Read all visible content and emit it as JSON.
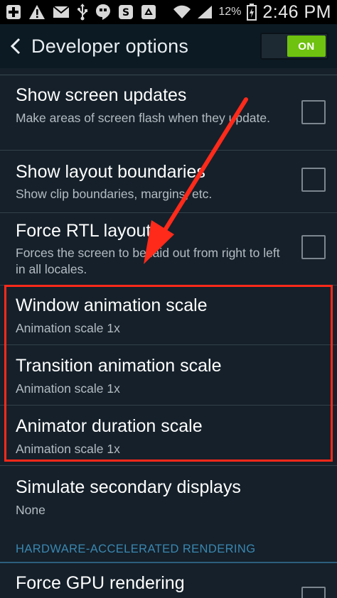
{
  "status_bar": {
    "battery_percent": "12%",
    "time": "2:46 PM",
    "left_icons": [
      "medical-plus-icon",
      "warning-icon",
      "mail-icon",
      "usb-icon",
      "hangouts-icon",
      "skype-icon",
      "recycle-icon"
    ],
    "right_icons": [
      "wifi-icon",
      "signal-icon",
      "battery-charging-icon"
    ]
  },
  "action_bar": {
    "title": "Developer options",
    "toggle_label": "ON",
    "accent_color": "#6fc20f"
  },
  "settings": [
    {
      "title": "Show screen updates",
      "subtitle": "Make areas of screen flash when they update.",
      "checked": false
    },
    {
      "title": "Show layout boundaries",
      "subtitle": "Show clip boundaries, margins, etc.",
      "checked": false
    },
    {
      "title": "Force RTL layout",
      "subtitle": "Forces the screen to be laid out from right to left in all locales.",
      "checked": false
    },
    {
      "title": "Window animation scale",
      "subtitle": "Animation scale 1x"
    },
    {
      "title": "Transition animation scale",
      "subtitle": "Animation scale 1x"
    },
    {
      "title": "Animator duration scale",
      "subtitle": "Animation scale 1x"
    },
    {
      "title": "Simulate secondary displays",
      "subtitle": "None"
    }
  ],
  "section_header": "HARDWARE-ACCELERATED RENDERING",
  "settings_2": [
    {
      "title": "Force GPU rendering",
      "checked": false
    }
  ],
  "annotation": {
    "highlight_color": "#ff2a1a"
  }
}
